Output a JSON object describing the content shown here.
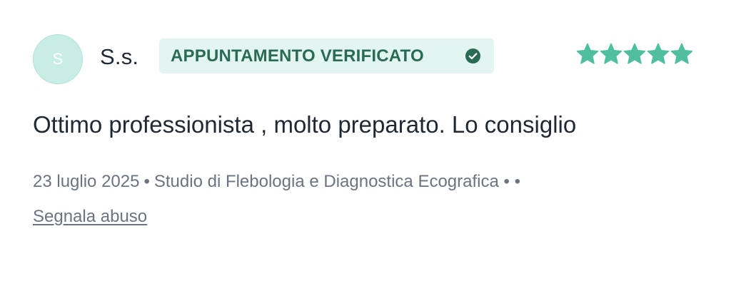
{
  "review": {
    "avatar_initial": "S",
    "author": "S.s.",
    "badge": {
      "label": "APPUNTAMENTO VERIFICATO",
      "icon": "check-circle-icon",
      "background": "#e3f5f0",
      "color": "#2a6b56"
    },
    "rating": {
      "value": 5,
      "max": 5,
      "star_color": "#4fbf9f"
    },
    "comment": "Ottimo professionista , molto preparato. Lo consiglio",
    "date": "23 luglio 2025",
    "location": "Studio di Flebologia e Diagnostica Ecografica",
    "trailing_dots": "• •",
    "report_link": "Segnala abuso"
  }
}
